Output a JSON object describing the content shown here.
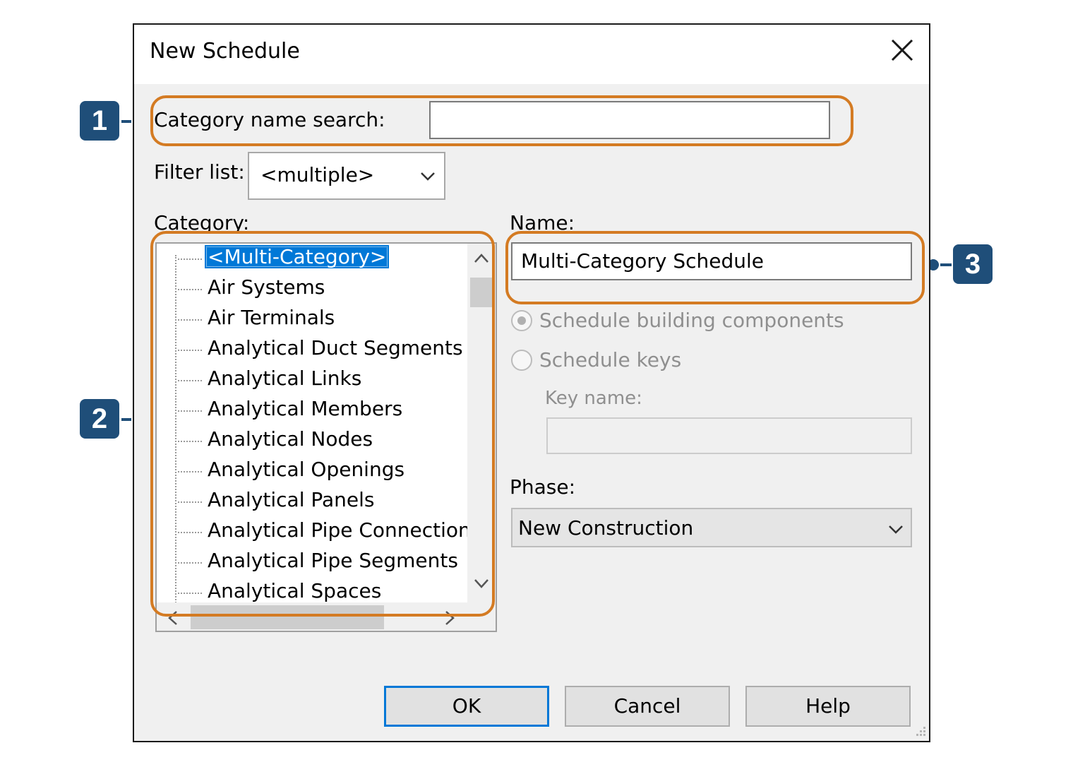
{
  "dialog": {
    "title": "New Schedule",
    "close_icon": "close-icon"
  },
  "search": {
    "label": "Category name search:",
    "value": ""
  },
  "filter": {
    "label": "Filter list:",
    "selected": "<multiple>"
  },
  "category": {
    "label": "Category:",
    "items": [
      "<Multi-Category>",
      "Air Systems",
      "Air Terminals",
      "Analytical Duct Segments",
      "Analytical Links",
      "Analytical Members",
      "Analytical Nodes",
      "Analytical Openings",
      "Analytical Panels",
      "Analytical Pipe Connections",
      "Analytical Pipe Segments",
      "Analytical Spaces"
    ],
    "selected_index": 0
  },
  "name": {
    "label": "Name:",
    "value": "Multi-Category Schedule"
  },
  "options": {
    "building_components": "Schedule building components",
    "schedule_keys": "Schedule keys",
    "key_name_label": "Key name:",
    "key_name_value": ""
  },
  "phase": {
    "label": "Phase:",
    "selected": "New Construction"
  },
  "buttons": {
    "ok": "OK",
    "cancel": "Cancel",
    "help": "Help"
  },
  "callouts": {
    "one": "1",
    "two": "2",
    "three": "3"
  },
  "colors": {
    "callout_orange": "#d47b23",
    "badge_navy": "#1f4e79",
    "selection_blue": "#0078d7"
  }
}
